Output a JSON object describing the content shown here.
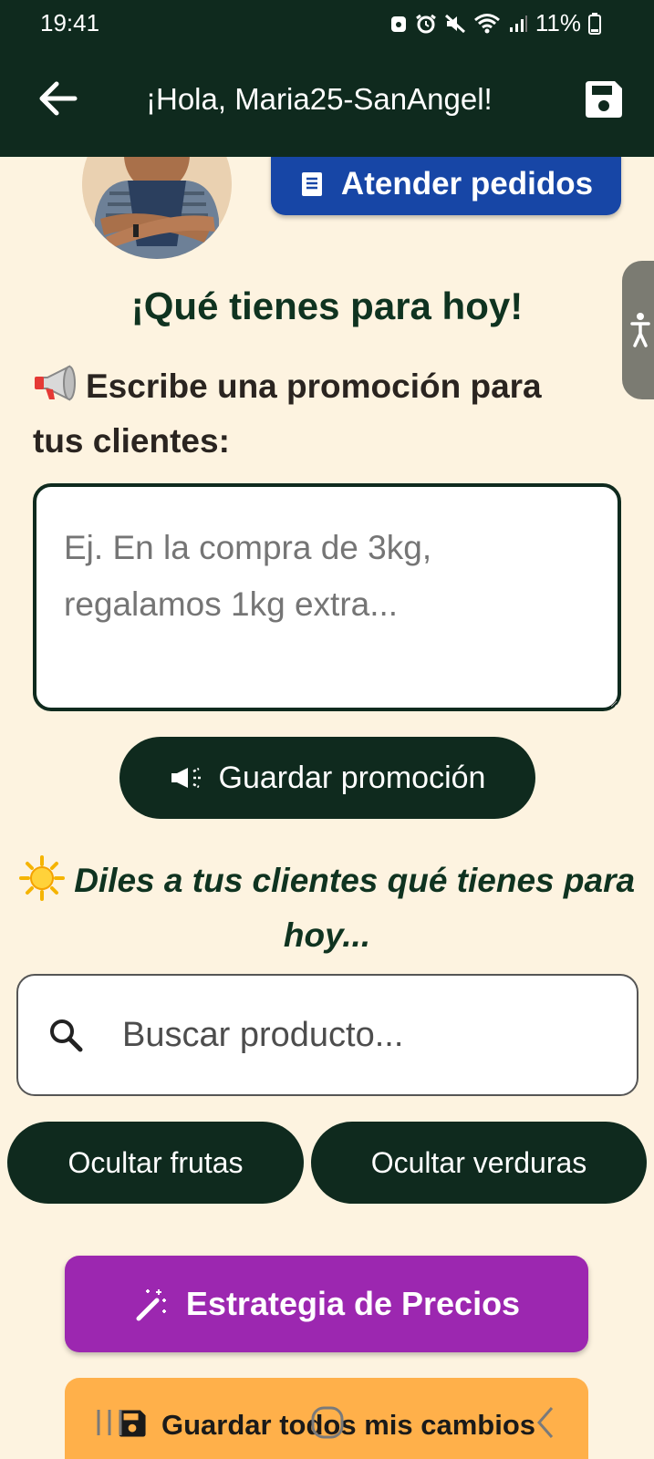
{
  "status_bar": {
    "time": "19:41",
    "battery": "11%"
  },
  "app_bar": {
    "title": "¡Hola, Maria25-SanAngel!",
    "back_icon": "arrow-left-icon",
    "save_icon": "floppy-disk-icon"
  },
  "orders_button": {
    "label": "Atender pedidos",
    "icon": "receipt-icon"
  },
  "heading": "¡Qué tienes para hoy!",
  "promotion": {
    "label": "Escribe una promoción para tus clientes:",
    "icon": "megaphone-icon",
    "placeholder": "Ej. En la compra de 3kg, regalamos 1kg extra...",
    "save_label": "Guardar promoción"
  },
  "today": {
    "label": "Diles a tus clientes qué tienes para hoy...",
    "icon": "sun-icon"
  },
  "search": {
    "placeholder": "Buscar producto..."
  },
  "filters": {
    "hide_fruits": "Ocultar frutas",
    "hide_veggies": "Ocultar verduras"
  },
  "pricing_button": {
    "label": "Estrategia de Precios",
    "icon": "magic-wand-icon"
  },
  "save_all_button": {
    "label": "Guardar todos mis cambios",
    "icon": "floppy-disk-icon"
  },
  "colors": {
    "primary_dark": "#0f2a1e",
    "background": "#fdf3e0",
    "orders_blue": "#1746a6",
    "pricing_purple": "#9c27b0",
    "save_orange": "#ffb04a"
  }
}
